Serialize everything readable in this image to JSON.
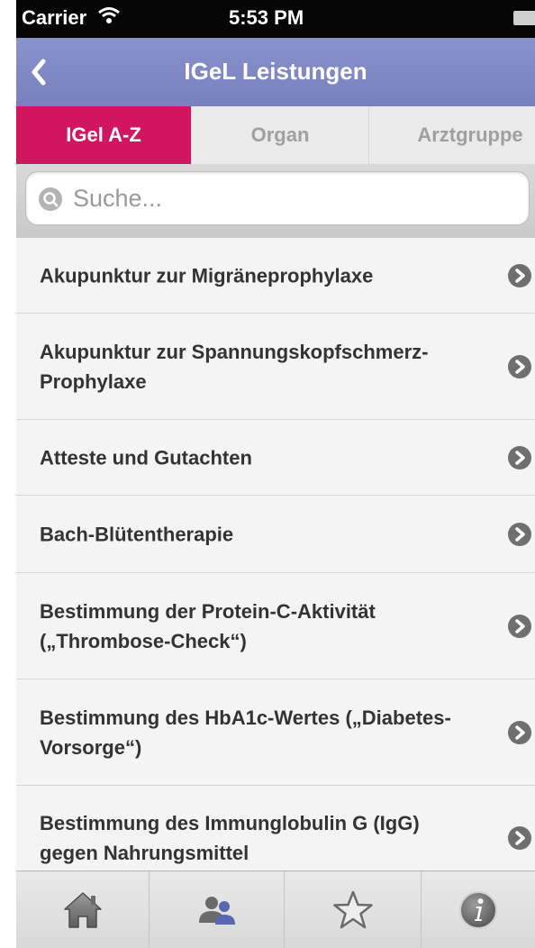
{
  "status_bar": {
    "carrier": "Carrier",
    "time": "5:53 PM",
    "icons": [
      "wifi-icon",
      "battery-icon"
    ]
  },
  "nav": {
    "title": "IGeL Leistungen",
    "back_icon": "chevron-left-icon"
  },
  "tabs": [
    {
      "label": "IGel A-Z",
      "selected": true
    },
    {
      "label": "Organ",
      "selected": false
    },
    {
      "label": "Arztgruppe",
      "selected": false
    }
  ],
  "search": {
    "placeholder": "Suche...",
    "value": "",
    "icon": "search-icon"
  },
  "list": {
    "items": [
      {
        "title": "Akupunktur zur Migräneprophylaxe"
      },
      {
        "title": "Akupunktur zur Spannungskopfschmerz-Prophylaxe"
      },
      {
        "title": "Atteste und Gutachten"
      },
      {
        "title": "Bach-Blütentherapie"
      },
      {
        "title": "Bestimmung der Protein-C-Aktivität („Thrombose-Check“)"
      },
      {
        "title": "Bestimmung des HbA1c-Wertes („Diabetes-Vorsorge“)"
      },
      {
        "title": "Bestimmung des Immunglobulin G (IgG) gegen Nahrungsmittel"
      }
    ],
    "disclosure_icon": "chevron-right-circle-icon"
  },
  "tab_bar": {
    "items": [
      {
        "icon": "home-icon"
      },
      {
        "icon": "people-icon"
      },
      {
        "icon": "star-icon"
      },
      {
        "icon": "info-icon"
      }
    ]
  },
  "colors": {
    "nav_bg": "#8088c6",
    "accent_pink": "#d2155f"
  }
}
